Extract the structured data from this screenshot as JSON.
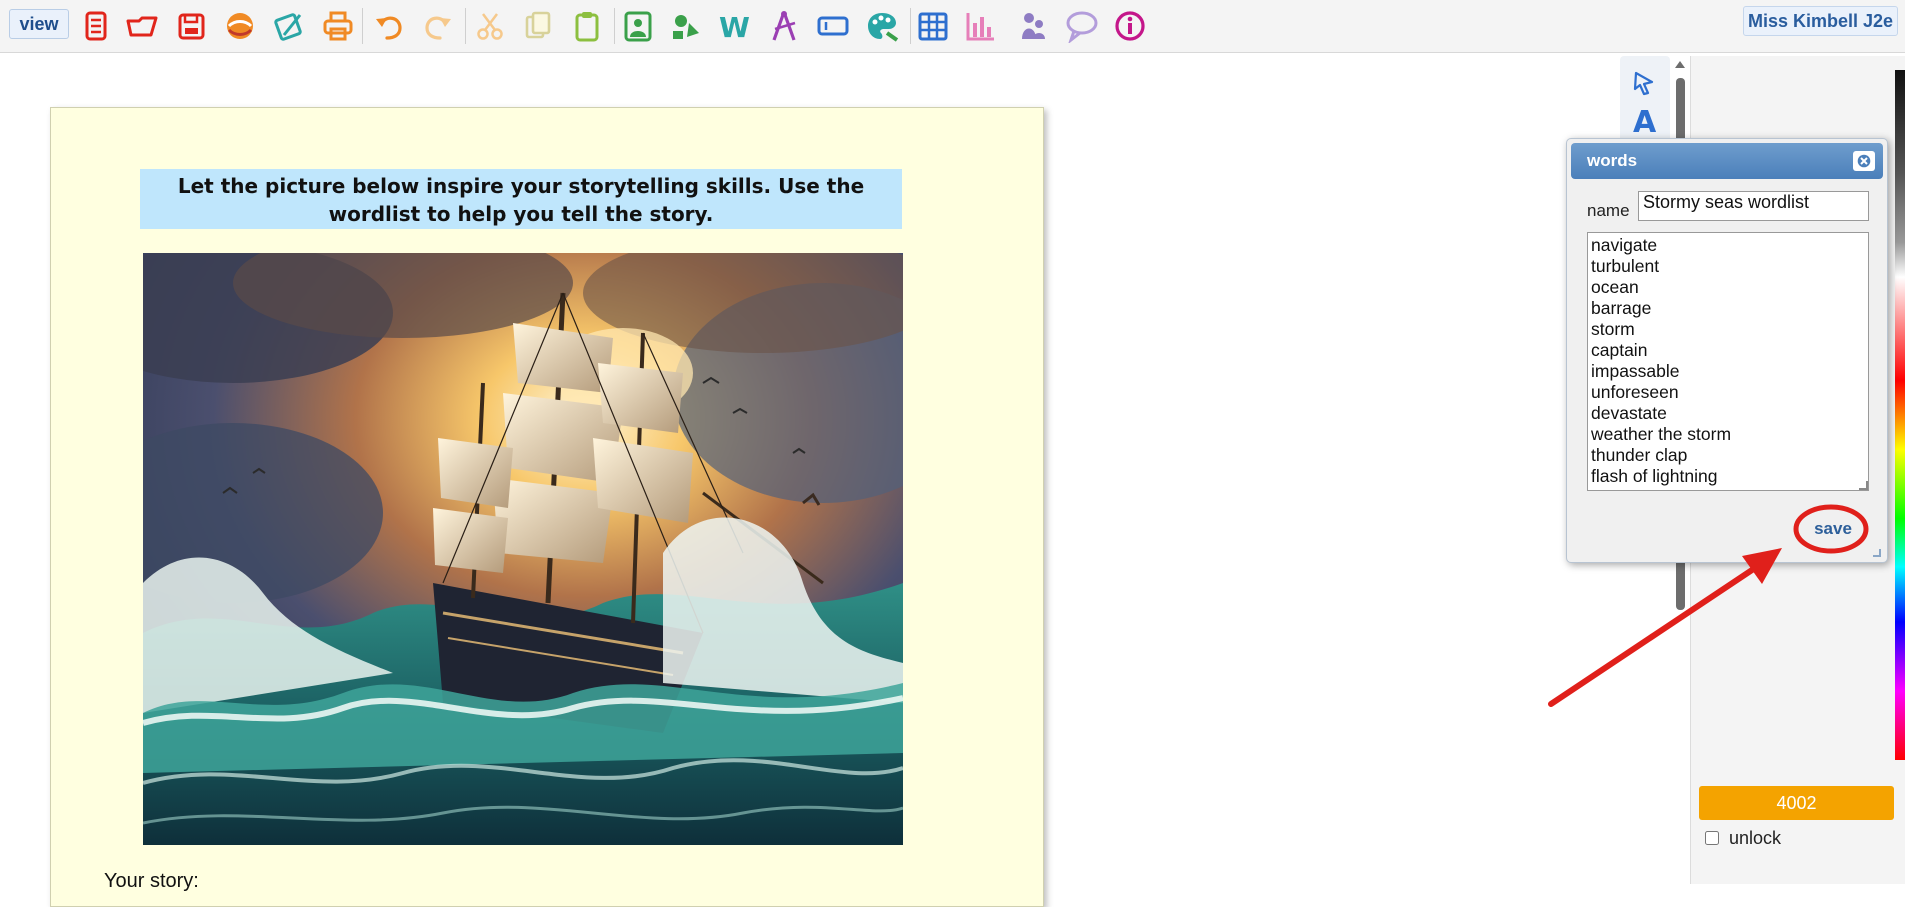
{
  "toolbar": {
    "view_label": "view",
    "user_name": "Miss Kimbell J2e",
    "icons": [
      "new-page-icon",
      "open-icon",
      "save-icon",
      "share-icon",
      "edit-icon",
      "print-icon",
      "undo-icon",
      "redo-icon",
      "cut-icon",
      "copy-icon",
      "paste-icon",
      "image-icon",
      "shapes-icon",
      "word-icon",
      "draw-icon",
      "text-box-icon",
      "paint-icon",
      "table-icon",
      "chart-icon",
      "character-icon",
      "speech-bubble-icon",
      "info-icon"
    ],
    "colors": {
      "red": "#e1251b",
      "orange": "#f08a24",
      "teal": "#2aa6a6",
      "green": "#3aa04a",
      "blue": "#2e6fcf",
      "purple": "#9b3fb3",
      "pink": "#e67fb9",
      "magenta": "#c4168a"
    }
  },
  "page": {
    "instruction": "Let the picture below inspire your storytelling skills.  Use the wordlist to help you tell the story.",
    "story_label": "Your story:",
    "background": "#ffffe0"
  },
  "dialog": {
    "title": "words",
    "name_label": "name",
    "name_value": "Stormy seas wordlist",
    "words": [
      "navigate",
      "turbulent",
      "ocean",
      "barrage",
      "storm",
      "captain",
      "impassable",
      "unforeseen",
      "devastate",
      "weather the storm",
      "thunder clap",
      "flash of lightning"
    ],
    "save_label": "save"
  },
  "sidebar": {
    "counter": "4002",
    "unlock_label": "unlock",
    "counter_color": "#f4a300"
  }
}
